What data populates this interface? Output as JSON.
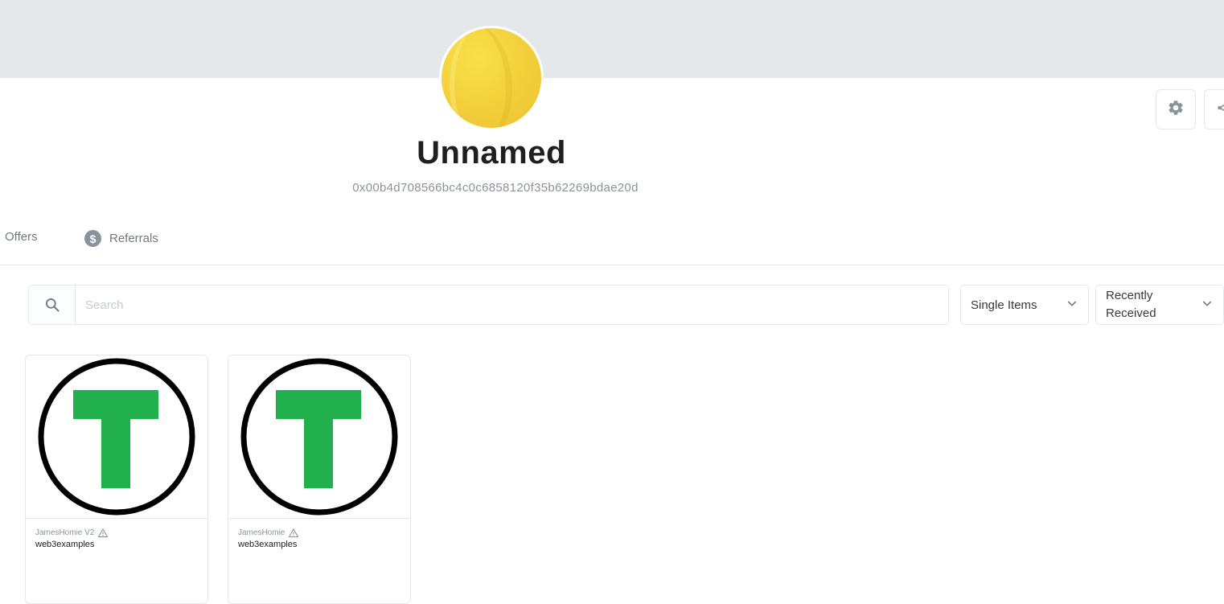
{
  "profile": {
    "name": "Unnamed",
    "address": "0x00b4d708566bc4c0c6858120f35b62269bdae20d",
    "avatar_colors": [
      "#f8e04a",
      "#edc132"
    ]
  },
  "actions": {
    "settings_icon": "gear-icon",
    "share_icon": "share-icon"
  },
  "tabs": [
    {
      "label": "Offers"
    },
    {
      "label": "Referrals",
      "icon": "dollar-icon"
    }
  ],
  "search": {
    "placeholder": "Search",
    "value": ""
  },
  "filters": {
    "type_selected": "Single Items",
    "sort_selected": "Recently Received"
  },
  "items": [
    {
      "collection": "JamesHomie V2",
      "name": "web3examples",
      "image": "t-logo",
      "warning": true
    },
    {
      "collection": "JamesHomie",
      "name": "web3examples",
      "image": "t-logo",
      "warning": true
    }
  ],
  "colors": {
    "banner": "#e5e8eb",
    "logo_green": "#22b04c",
    "muted_text": "#8a939b"
  }
}
